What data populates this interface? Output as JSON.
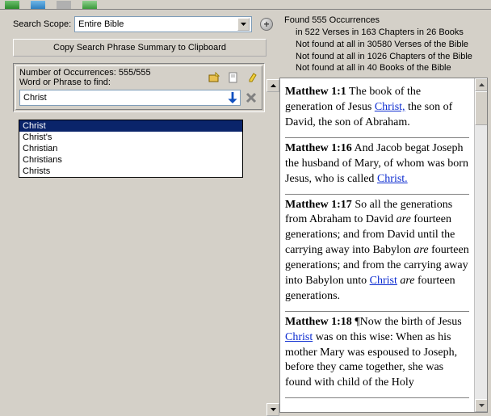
{
  "toolbar": {
    "scope_label": "Search Scope:"
  },
  "scope": {
    "selected": "Entire Bible"
  },
  "copy_button": "Copy Search Phrase Summary to Clipboard",
  "occurrence": {
    "count_label": "Number of Occurrences: 555/555",
    "find_label": "Word or Phrase to find:",
    "input_value": "Christ"
  },
  "autocomplete": [
    "Christ",
    "Christ's",
    "Christian",
    "Christians",
    "Christs"
  ],
  "stats": {
    "line1": "Found 555 Occurrences",
    "line2": "in 522 Verses in 163 Chapters in 26 Books",
    "line3": "Not found at all in 30580 Verses of the Bible",
    "line4": "Not found at all in 1026 Chapters of the Bible",
    "line5": "Not found at all in 40 Books of the Bible"
  },
  "results": [
    {
      "ref": "Matthew 1:1",
      "pre": " The book of the generation of Jesus ",
      "hw": "Christ,",
      "post": " the son of David, the son of Abraham."
    },
    {
      "ref": "Matthew 1:16",
      "pre": " And Jacob begat Joseph the husband of Mary, of whom was born Jesus, who is called ",
      "hw": "Christ.",
      "post": ""
    },
    {
      "ref": "Matthew 1:17",
      "html": " So all the generations from Abraham to David <i>are</i> fourteen generations; and from David until the carrying away into Babylon <i>are</i> fourteen generations; and from the carrying away into Babylon unto <span class='hw'>Christ</span> <i>are</i> fourteen generations."
    },
    {
      "ref": "Matthew 1:18",
      "html": " ¶Now the birth of Jesus <span class='hw'>Christ</span> was on this wise: When as his mother Mary was espoused to Joseph, before they came together, she was found with child of the Holy"
    }
  ]
}
